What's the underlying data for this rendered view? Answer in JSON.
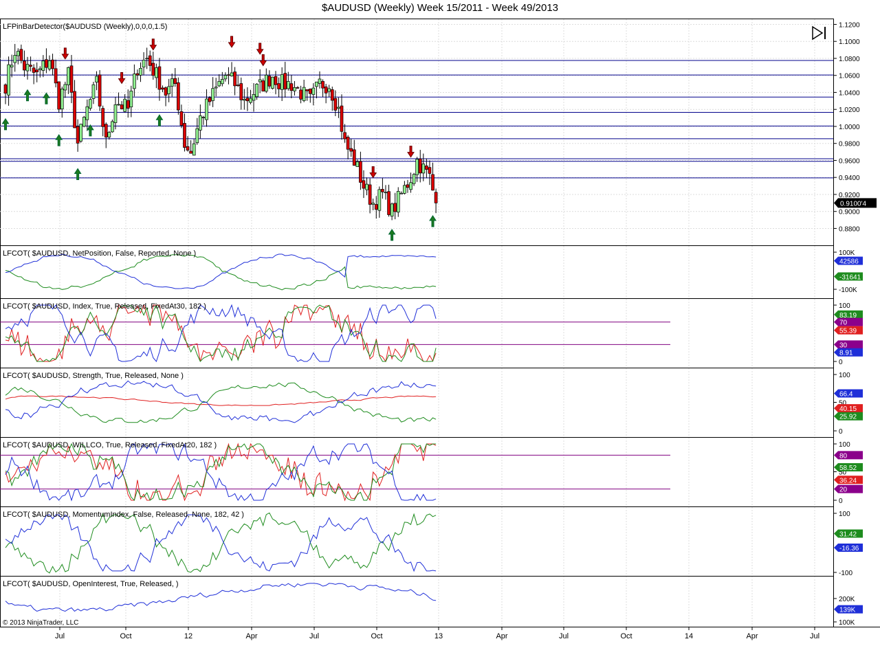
{
  "title": "$AUDUSD (Weekly)  Week 15/2011 - Week 49/2013",
  "copyright": "© 2013 NinjaTrader, LLC",
  "colors": {
    "up": "#90EE90",
    "down": "#DC0000",
    "hline": "#00008B",
    "cot_blue": "#1F2FD8",
    "cot_green": "#1E8C1E",
    "cot_red": "#E02020",
    "level_line": "#800080",
    "grid": "#DCDCDC"
  },
  "x_axis": {
    "labels": [
      "Jul",
      "Oct",
      "12",
      "Apr",
      "Jul",
      "Oct",
      "13",
      "Apr",
      "Jul",
      "Oct",
      "14",
      "Apr",
      "Jul"
    ]
  },
  "price_panel": {
    "label": "LFPinBarDetector($AUDUSD (Weekly),0,0,0,1.5)",
    "ticks": [
      "1.1200",
      "1.1000",
      "1.0800",
      "1.0600",
      "1.0400",
      "1.0200",
      "1.0000",
      "0.9800",
      "0.9600",
      "0.9400",
      "0.9200",
      "0.9000",
      "0.8800"
    ],
    "last_price": "0.9100'4",
    "horizontal_levels": [
      1.0775,
      1.0605,
      1.0345,
      1.0165,
      1.0005,
      0.9855,
      0.962,
      0.959,
      0.9395
    ]
  },
  "panels": [
    {
      "label": "LFCOT( $AUDUSD, NetPosition, False, Reported, None )",
      "ticks": [
        "100K",
        "-100K"
      ],
      "badges": [
        {
          "text": "42586",
          "color": "#1F2FD8"
        },
        {
          "text": "-31641",
          "color": "#1E8C1E"
        }
      ]
    },
    {
      "label": "LFCOT( $AUDUSD, Index, True, Released, FixedAt30, 182 )",
      "ticks": [
        "100",
        "0"
      ],
      "badges": [
        {
          "text": "83.19",
          "color": "#1E8C1E"
        },
        {
          "text": "70",
          "color": "#8B008B"
        },
        {
          "text": "55.39",
          "color": "#E02020"
        },
        {
          "text": "30",
          "color": "#8B008B"
        },
        {
          "text": "8.91",
          "color": "#1F2FD8"
        }
      ]
    },
    {
      "label": "LFCOT( $AUDUSD, Strength, True, Released, None )",
      "ticks": [
        "100",
        "50",
        "0"
      ],
      "badges": [
        {
          "text": "66.4",
          "color": "#1F2FD8"
        },
        {
          "text": "40.15",
          "color": "#E02020"
        },
        {
          "text": "25.92",
          "color": "#1E8C1E"
        }
      ]
    },
    {
      "label": "LFCOT( $AUDUSD, WILLCO, True, Released, FixedAt20, 182 )",
      "ticks": [
        "100",
        "50",
        "0"
      ],
      "badges": [
        {
          "text": "80",
          "color": "#8B008B"
        },
        {
          "text": "58.52",
          "color": "#1E8C1E"
        },
        {
          "text": "36.24",
          "color": "#E02020"
        },
        {
          "text": "20",
          "color": "#8B008B"
        }
      ]
    },
    {
      "label": "LFCOT( $AUDUSD, MomentumIndex, False, Released, None, 182, 42 )",
      "ticks": [
        "100",
        "-100"
      ],
      "badges": [
        {
          "text": "31.42",
          "color": "#1E8C1E"
        },
        {
          "text": "-16.36",
          "color": "#1F2FD8"
        }
      ]
    },
    {
      "label": "LFCOT( $AUDUSD, OpenInterest, True, Released,  )",
      "ticks": [
        "200K",
        "100K"
      ],
      "badges": [
        {
          "text": "139K",
          "color": "#1F2FD8"
        }
      ]
    }
  ],
  "chart_data": [
    {
      "type": "candlestick",
      "title": "$AUDUSD (Weekly)  Week 15/2011 - Week 49/2013",
      "y_range": [
        0.87,
        1.12
      ],
      "close_anchors": [
        [
          0,
          1.05
        ],
        [
          3,
          1.09
        ],
        [
          6,
          1.07
        ],
        [
          10,
          1.06
        ],
        [
          14,
          1.08
        ],
        [
          17,
          1.03
        ],
        [
          20,
          1.06
        ],
        [
          23,
          0.98
        ],
        [
          26,
          1.02
        ],
        [
          29,
          1.05
        ],
        [
          32,
          0.98
        ],
        [
          35,
          1.03
        ],
        [
          39,
          1.02
        ],
        [
          42,
          1.07
        ],
        [
          45,
          1.08
        ],
        [
          48,
          1.06
        ],
        [
          51,
          1.04
        ],
        [
          54,
          1.05
        ],
        [
          57,
          0.98
        ],
        [
          59,
          0.97
        ],
        [
          62,
          1.01
        ],
        [
          65,
          1.03
        ],
        [
          68,
          1.05
        ],
        [
          70,
          1.06
        ],
        [
          73,
          1.05
        ],
        [
          76,
          1.03
        ],
        [
          79,
          1.04
        ],
        [
          82,
          1.05
        ],
        [
          85,
          1.06
        ],
        [
          88,
          1.05
        ],
        [
          91,
          1.05
        ],
        [
          94,
          1.04
        ],
        [
          97,
          1.03
        ],
        [
          100,
          1.05
        ],
        [
          103,
          1.05
        ],
        [
          106,
          1.02
        ],
        [
          108,
          0.98
        ],
        [
          111,
          0.96
        ],
        [
          114,
          0.93
        ],
        [
          117,
          0.91
        ],
        [
          120,
          0.92
        ],
        [
          123,
          0.9
        ],
        [
          126,
          0.92
        ],
        [
          129,
          0.94
        ],
        [
          131,
          0.96
        ],
        [
          133,
          0.95
        ],
        [
          135,
          0.94
        ],
        [
          137,
          0.91
        ]
      ],
      "pin_bars_down_weeks": [
        19,
        37,
        47,
        72,
        81,
        82,
        117,
        129
      ],
      "pin_bars_up_weeks": [
        0,
        7,
        13,
        17,
        23,
        27,
        49,
        123,
        136
      ]
    },
    {
      "type": "line",
      "series": [
        {
          "name": "NetPosition"
        },
        {
          "name": "NetPosition-2"
        }
      ],
      "last_values": [
        42586,
        -31641
      ]
    },
    {
      "type": "line",
      "series": [
        {
          "name": "Index-1"
        },
        {
          "name": "Index-2"
        },
        {
          "name": "Index-3"
        }
      ],
      "last_values": [
        8.91,
        83.19,
        55.39
      ],
      "levels": [
        70,
        30
      ]
    },
    {
      "type": "line",
      "last_values": [
        66.4,
        25.92,
        40.15
      ]
    },
    {
      "type": "line",
      "last_values": [
        36.24,
        58.52,
        50
      ],
      "levels": [
        80,
        20
      ]
    },
    {
      "type": "line",
      "last_values": [
        -16.36,
        31.42
      ]
    },
    {
      "type": "line",
      "last_values": [
        139000
      ]
    }
  ]
}
